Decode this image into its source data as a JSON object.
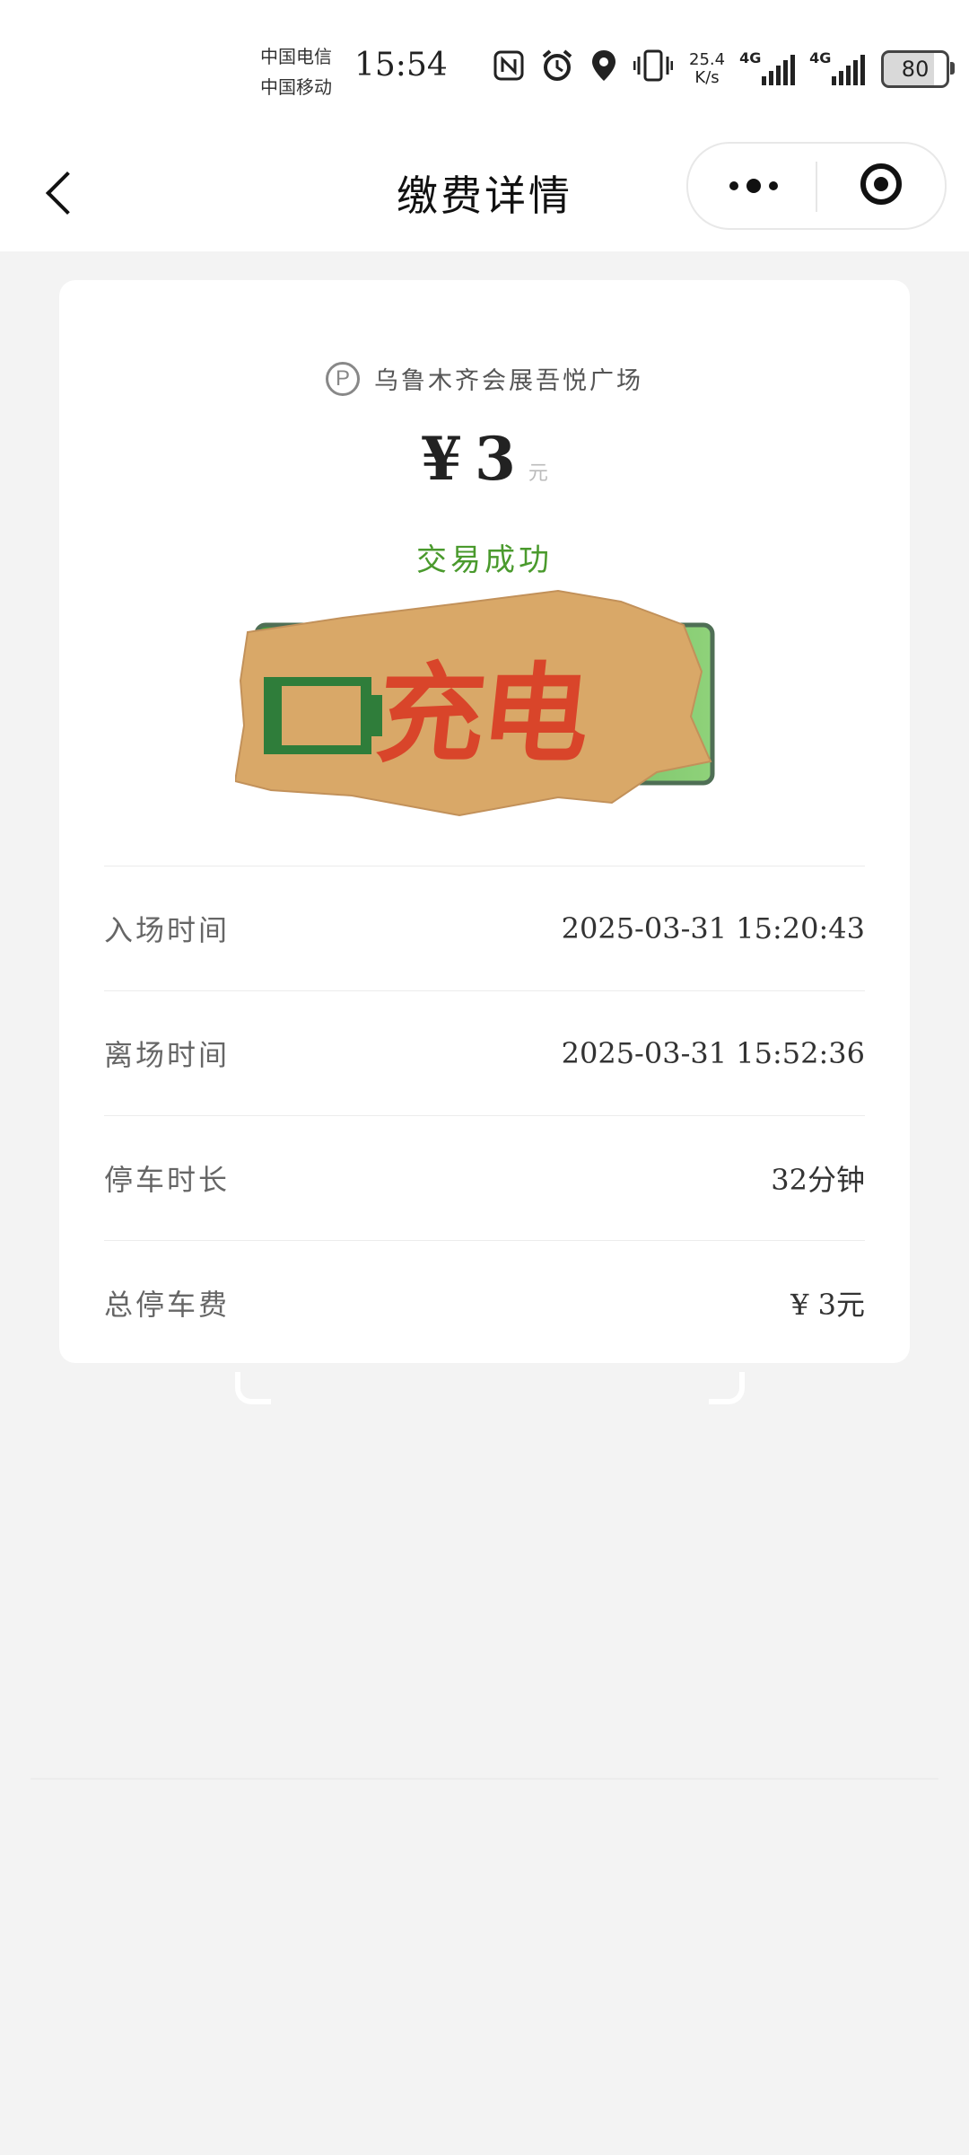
{
  "status_bar": {
    "carrier1": "中国电信",
    "carrier2": "中国移动",
    "time": "15:54",
    "net_speed_value": "25.4",
    "net_speed_unit": "K/s",
    "signal1_label": "4G",
    "signal2_label": "4G",
    "battery": "80",
    "icons": [
      "nfc-icon",
      "alarm-icon",
      "location-icon",
      "vibrate-icon"
    ]
  },
  "nav": {
    "title": "缴费详情",
    "menu_icon": "more-dots-icon",
    "close_icon": "target-icon"
  },
  "card": {
    "lot_icon": "P",
    "lot_name": "乌鲁木齐会展吾悦广场",
    "amount_symbol": "¥",
    "amount_value": "3",
    "amount_unit": "元",
    "status": "交易成功",
    "sticker_text": "充电",
    "rows": [
      {
        "label": "入场时间",
        "value": "2025-03-31 15:20:43"
      },
      {
        "label": "离场时间",
        "value": "2025-03-31 15:52:36"
      },
      {
        "label": "停车时长",
        "value": "32分钟"
      },
      {
        "label": "总停车费",
        "value": "¥ 3元"
      }
    ]
  },
  "colors": {
    "success": "#4a9a2d",
    "sticker_paper": "#d9a868",
    "sticker_text": "#d9452a",
    "battery_green": "#2f7d3a"
  }
}
